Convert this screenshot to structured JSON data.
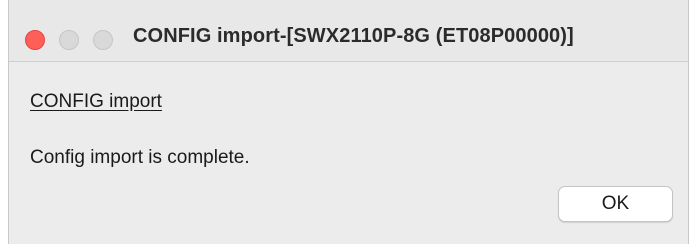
{
  "window": {
    "title": "CONFIG import-[SWX2110P-8G (ET08P00000)]"
  },
  "dialog": {
    "heading": "CONFIG import",
    "message": "Config import is complete.",
    "ok_label": "OK"
  },
  "colors": {
    "close_button": "#fe5f57",
    "inactive_button": "#d9d9d9",
    "window_background": "#ececec"
  },
  "icons": [
    "close-window-icon",
    "minimize-window-icon",
    "zoom-window-icon"
  ]
}
